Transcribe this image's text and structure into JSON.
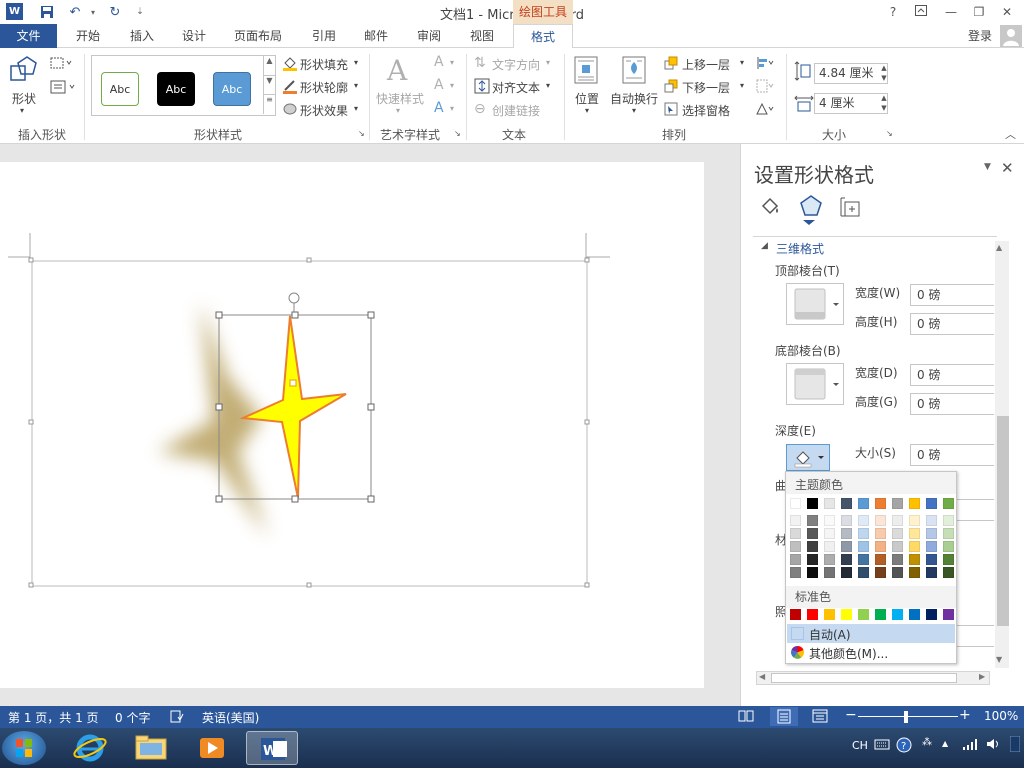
{
  "domain": "Computer-Use",
  "title_bar": {
    "doc_title": "文档1 - Microsoft Word",
    "context_group": "绘图工具",
    "help": "?"
  },
  "tabs": [
    {
      "label": "文件"
    },
    {
      "label": "开始"
    },
    {
      "label": "插入"
    },
    {
      "label": "设计"
    },
    {
      "label": "页面布局"
    },
    {
      "label": "引用"
    },
    {
      "label": "邮件"
    },
    {
      "label": "审阅"
    },
    {
      "label": "视图"
    },
    {
      "label": "格式"
    }
  ],
  "login": "登录",
  "ribbon": {
    "insert_shapes": {
      "shape_label": "形状",
      "group": "插入形状"
    },
    "shape_styles": {
      "samples": [
        "Abc",
        "Abc",
        "Abc"
      ],
      "fill": "形状填充",
      "outline": "形状轮廓",
      "effects": "形状效果",
      "group": "形状样式"
    },
    "wordart": {
      "quick_styles": "快速样式",
      "group": "艺术字样式"
    },
    "text": {
      "direction": "文字方向",
      "align": "对齐文本",
      "link": "创建链接",
      "group": "文本"
    },
    "arrange": {
      "position": "位置",
      "wrap": "自动换行",
      "forward": "上移一层",
      "backward": "下移一层",
      "selection_pane": "选择窗格",
      "group": "排列"
    },
    "size": {
      "height": "4.84 厘米",
      "width": "4 厘米",
      "group": "大小"
    }
  },
  "pane": {
    "title": "设置形状格式",
    "section": "三维格式",
    "top_bevel": "顶部棱台(T)",
    "top_width_label": "宽度(W)",
    "top_width": "0 磅",
    "top_height_label": "高度(H)",
    "top_height": "0 磅",
    "bottom_bevel": "底部棱台(B)",
    "bottom_width_label": "宽度(D)",
    "bottom_width": "0 磅",
    "bottom_height_label": "高度(G)",
    "bottom_height": "0 磅",
    "depth": "深度(E)",
    "size_label": "大小(S)",
    "size": "0 磅",
    "contour_partial": "曲",
    "material_partial": "材",
    "lighting_partial": "照"
  },
  "color_popup": {
    "theme_title": "主题颜色",
    "standard_title": "标准色",
    "auto": "自动(A)",
    "more": "其他颜色(M)...",
    "theme_top": [
      "#ffffff",
      "#000000",
      "#e7e6e6",
      "#44546a",
      "#5b9bd5",
      "#ed7d31",
      "#a5a5a5",
      "#ffc000",
      "#4472c4",
      "#70ad47"
    ],
    "standard": [
      "#c00000",
      "#ff0000",
      "#ffc000",
      "#ffff00",
      "#92d050",
      "#00b050",
      "#00b0f0",
      "#0070c0",
      "#002060",
      "#7030a0"
    ]
  },
  "status": {
    "page": "第 1 页，共 1 页",
    "words": "0 个字",
    "language": "英语(美国)",
    "zoom": "100%"
  },
  "taskbar": {
    "ime": "CH"
  },
  "colors": {
    "accent": "#2b579a",
    "context": "#c43e1c",
    "star_fill": "#ffff00",
    "star_outline": "#ed7d31"
  }
}
